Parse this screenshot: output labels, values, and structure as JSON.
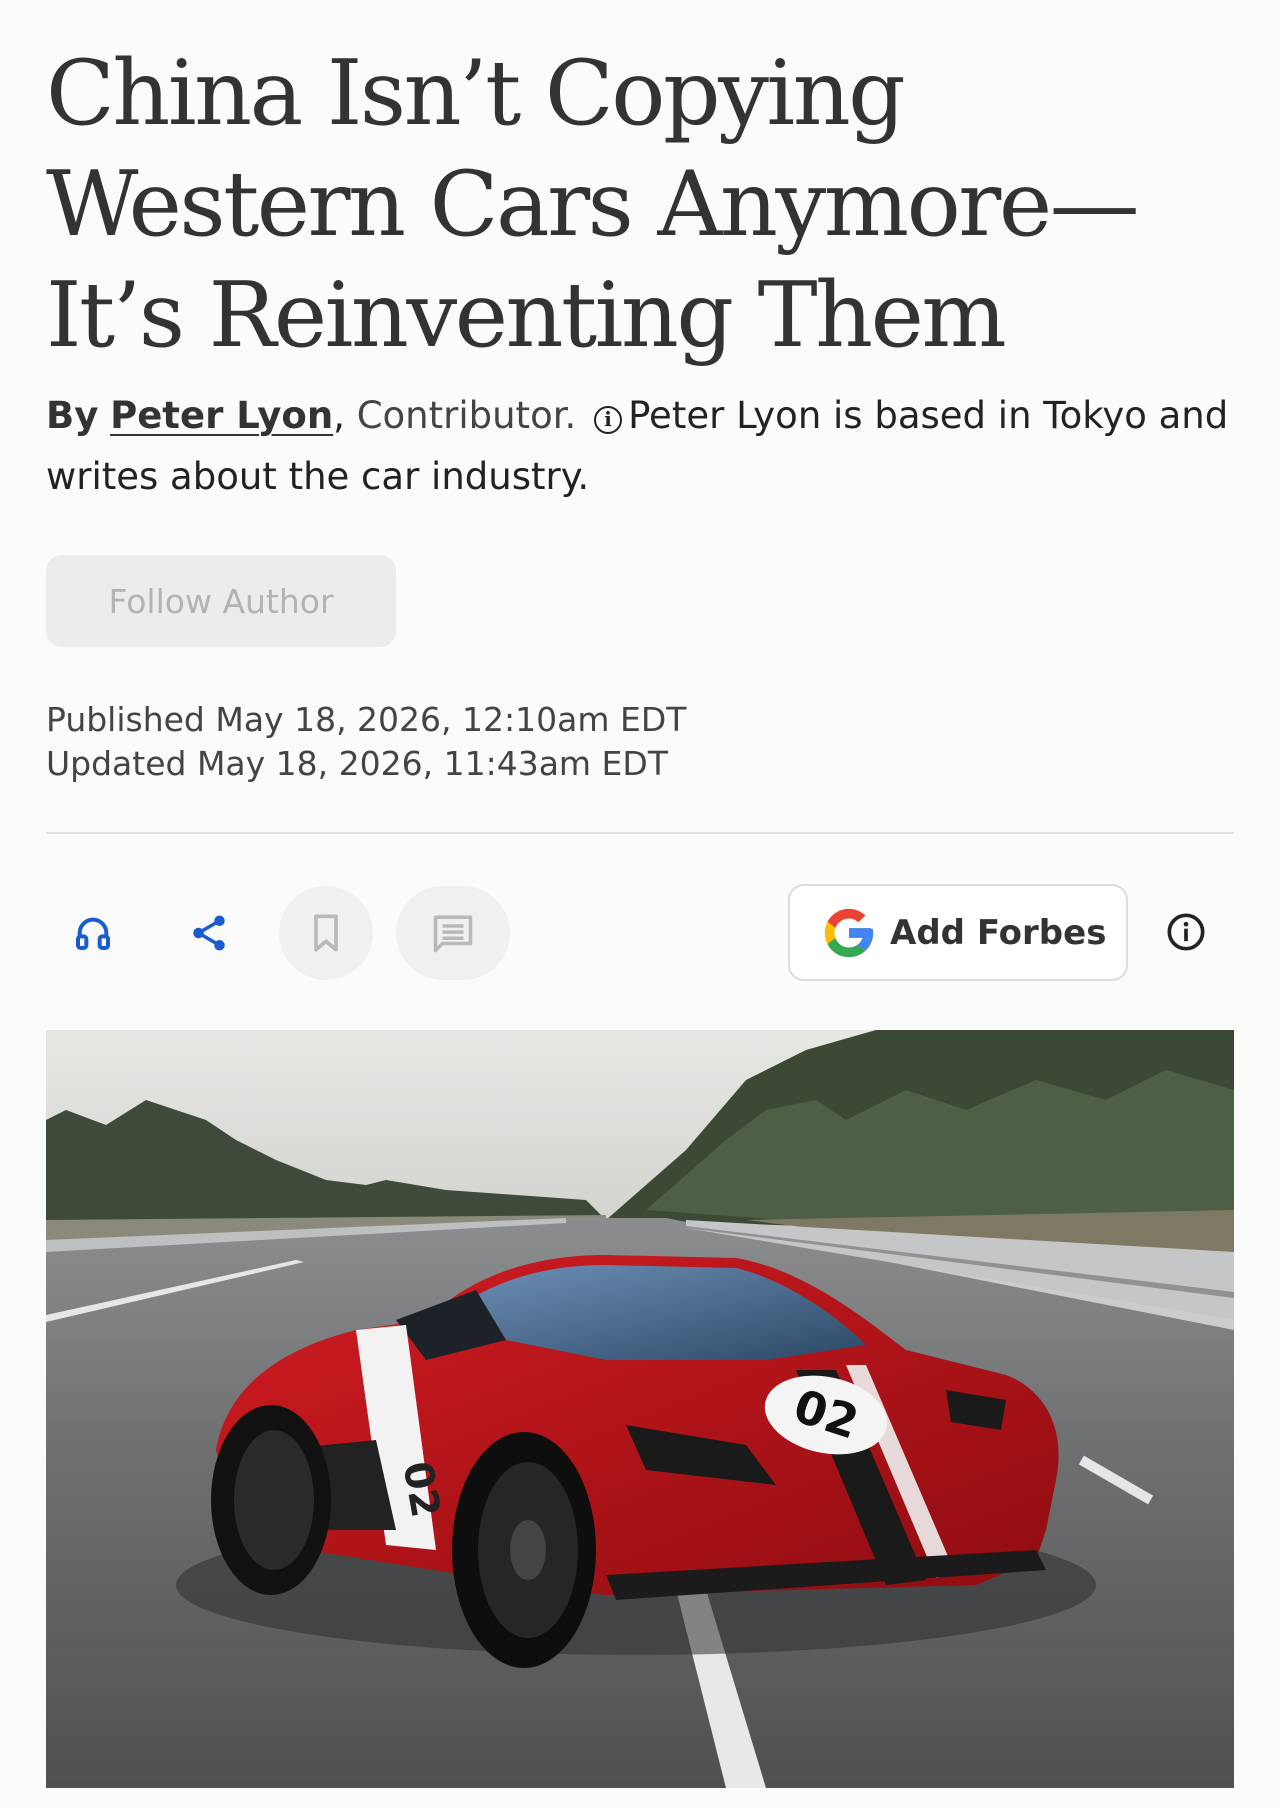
{
  "article": {
    "headline": "China Isn’t Copying Western Cars Anymore—It’s Reinventing Them",
    "byline": {
      "by": "By",
      "author": "Peter Lyon",
      "comma": ",",
      "role": "Contributor.",
      "info_glyph": "i",
      "bio": "Peter Lyon is based in Tokyo and writes about the car industry."
    },
    "follow_label": "Follow Author",
    "published": "Published May 18, 2026, 12:10am EDT",
    "updated": "Updated May 18, 2026, 11:43am EDT"
  },
  "toolbar": {
    "listen_icon": "headphones-icon",
    "share_icon": "share-icon",
    "bookmark_icon": "bookmark-icon",
    "comments_icon": "comments-icon",
    "add_source_label": "Add Forbes",
    "add_source_icon": "google-g-logo",
    "info_icon": "info-icon"
  },
  "hero_image": {
    "car_number": "02"
  },
  "colors": {
    "text": "#333333",
    "link_blue": "#1a5ccf",
    "google_blue": "#4285F4",
    "google_red": "#EA4335",
    "google_yellow": "#FBBC05",
    "google_green": "#34A853",
    "car_red": "#c4161c"
  }
}
